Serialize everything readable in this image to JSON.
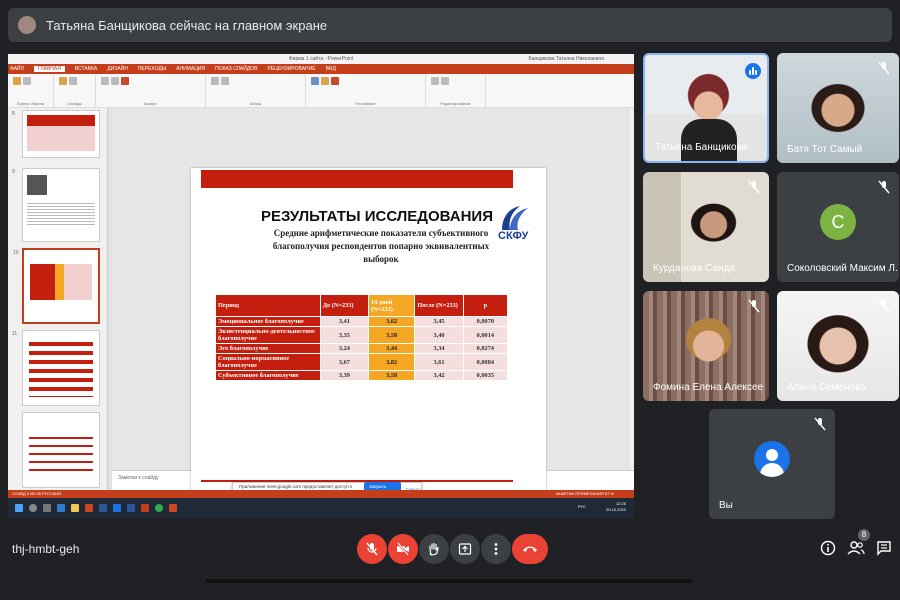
{
  "meet": {
    "presenter_banner": "Татьяна Банщикова сейчас на главном экране",
    "meeting_code": "thj-hmbt-geh",
    "participants_count": "8",
    "you_label": "Вы",
    "participants": [
      {
        "name": "Татьяна Банщикова",
        "initial": ""
      },
      {
        "name": "Батя Тот Самый",
        "initial": ""
      },
      {
        "name": "Курданова Саида",
        "initial": ""
      },
      {
        "name": "Соколовский Максим Л...",
        "initial": "С"
      },
      {
        "name": "Фомина Елена Алексее...",
        "initial": ""
      },
      {
        "name": "Алина Семенова",
        "initial": ""
      }
    ]
  },
  "ppt": {
    "window_title": "Фирма 1 сайта - PowerPoint",
    "user": "Банщикова Татьяна Николаевна",
    "tabs": [
      "ФАЙЛ",
      "ГЛАВНАЯ",
      "ВСТАВКА",
      "ДИЗАЙН",
      "ПЕРЕХОДЫ",
      "АНИМАЦИЯ",
      "ПОКАЗ СЛАЙДОВ",
      "РЕЦЕНЗИРОВАНИЕ",
      "ВИД"
    ],
    "ribbon_groups": [
      "Буфер обмена",
      "Слайды",
      "Шрифт",
      "Абзац",
      "Рисование",
      "Редактирование"
    ],
    "notes_placeholder": "Заметки к слайду",
    "status_left": "СЛАЙД 9 ИЗ 36   РУССКИЙ",
    "status_right": "ЗАМЕТКИ   ПРИМЕЧАНИЯ   57 %",
    "thumb_numbers": [
      "8",
      "9",
      "10",
      "11"
    ],
    "toast_text": "Приложение meet.google.com предоставляет доступ к вашему экрану.",
    "toast_stop": "Закрыть доступ",
    "toast_hide": "Скрыть",
    "clock_time": "12:26",
    "clock_date": "20.10.2022",
    "clock_lang": "РУС"
  },
  "slide": {
    "title": "РЕЗУЛЬТАТЫ ИССЛЕДОВАНИЯ",
    "subtitle": "Средние арифметические показатели субъективного благополучия респондентов попарно эквивалентных выборок",
    "logo_text": "СКФУ",
    "table": {
      "headers": [
        "Период",
        "До (N=233)",
        "14 дней (N=233)",
        "После (N=233)",
        "p"
      ],
      "rows": [
        [
          "Эмоциональное благополучие",
          "3,41",
          "3,62",
          "3,45",
          "0,0070"
        ],
        [
          "Экзистенциально-деятельностное благополучие",
          "3,35",
          "3,58",
          "3,40",
          "0,0014"
        ],
        [
          "Эго благополучие",
          "3,24",
          "3,44",
          "3,34",
          "0,0274"
        ],
        [
          "Социально-нормативное благополучие",
          "3,67",
          "3,82",
          "3,61",
          "0,0084"
        ],
        [
          "Субъективное благополучие",
          "3,39",
          "3,58",
          "3,42",
          "0,0035"
        ]
      ]
    }
  },
  "colors": {
    "meet_bg": "#202124",
    "ppt_accent": "#c43e1c",
    "slide_red": "#c41e0e",
    "highlight": "#f5a623",
    "leave_red": "#ea4335"
  }
}
